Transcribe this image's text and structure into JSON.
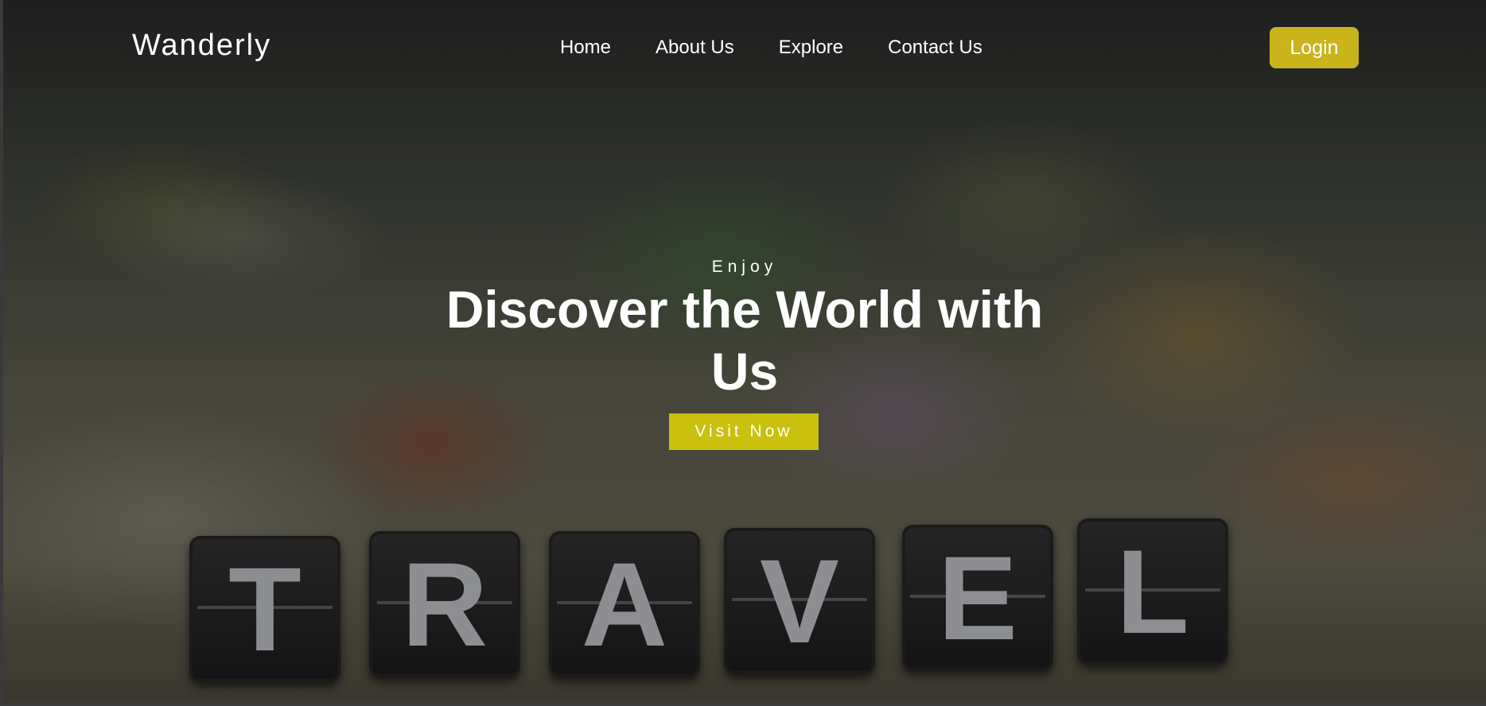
{
  "brand": "Wanderly",
  "nav": {
    "items": [
      {
        "label": "Home"
      },
      {
        "label": "About Us"
      },
      {
        "label": "Explore"
      },
      {
        "label": "Contact Us"
      }
    ],
    "login_label": "Login"
  },
  "hero": {
    "kicker": "Enjoy",
    "headline": "Discover the World with Us",
    "cta_label": "Visit Now",
    "tiles": [
      "T",
      "R",
      "A",
      "V",
      "E",
      "L"
    ]
  },
  "colors": {
    "login_button": "#c9b41a",
    "cta_button": "#c9c10e",
    "text": "#ffffff"
  }
}
